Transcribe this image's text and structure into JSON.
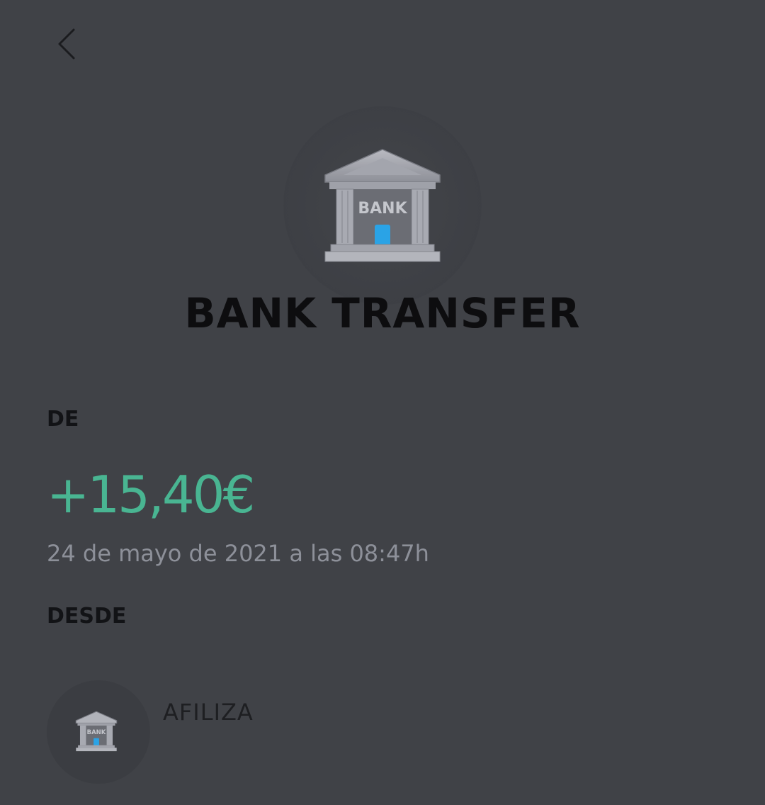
{
  "header": {
    "back_icon": "chevron-left-icon"
  },
  "hero": {
    "icon": "bank-icon",
    "icon_label": "BANK",
    "title": "BANK TRANSFER"
  },
  "details": {
    "de_label": "DE",
    "amount": "+15,40€",
    "datetime": "24 de mayo de 2021 a las 08:47h",
    "desde_label": "DESDE"
  },
  "source": {
    "icon": "bank-icon",
    "icon_label": "BANK",
    "name": "AFILIZA"
  },
  "colors": {
    "background": "#404247",
    "amount_positive": "#49b592",
    "secondary_text": "#8d9099",
    "bank_door": "#2aa3e6"
  }
}
